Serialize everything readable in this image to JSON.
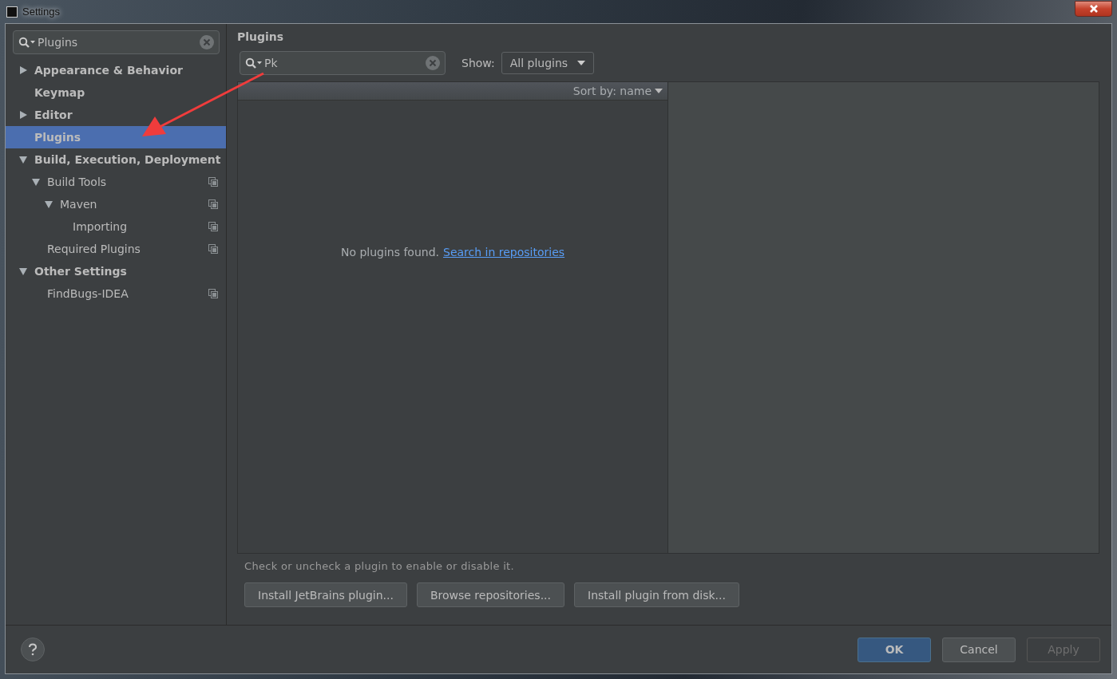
{
  "window": {
    "title": "Settings"
  },
  "sidebar": {
    "search": {
      "value": "Plugins"
    },
    "items": [
      {
        "label": "Appearance & Behavior",
        "expanded": false,
        "selected": false,
        "project_icon": false
      },
      {
        "label": "Keymap",
        "selected": false,
        "project_icon": false
      },
      {
        "label": "Editor",
        "expanded": false,
        "selected": false,
        "project_icon": false
      },
      {
        "label": "Plugins",
        "selected": true,
        "project_icon": false
      },
      {
        "label": "Build, Execution, Deployment",
        "expanded": true,
        "selected": false,
        "project_icon": false,
        "children": [
          {
            "label": "Build Tools",
            "expanded": true,
            "selected": false,
            "project_icon": true,
            "children": [
              {
                "label": "Maven",
                "expanded": true,
                "selected": false,
                "project_icon": true,
                "children": [
                  {
                    "label": "Importing",
                    "selected": false,
                    "project_icon": true
                  }
                ]
              }
            ]
          },
          {
            "label": "Required Plugins",
            "selected": false,
            "project_icon": true
          }
        ]
      },
      {
        "label": "Other Settings",
        "expanded": true,
        "selected": false,
        "project_icon": false,
        "children": [
          {
            "label": "FindBugs-IDEA",
            "selected": false,
            "project_icon": true
          }
        ]
      }
    ]
  },
  "content": {
    "title": "Plugins",
    "search": {
      "value": "Pk"
    },
    "show_label": "Show:",
    "show_value": "All plugins",
    "sort_label": "Sort by: name",
    "empty_text": "No plugins found.",
    "empty_link": "Search in repositories",
    "hint": "Check or uncheck a plugin to enable or disable it.",
    "buttons": [
      "Install JetBrains plugin...",
      "Browse repositories...",
      "Install plugin from disk..."
    ]
  },
  "footer": {
    "buttons": [
      {
        "label": "OK",
        "kind": "primary",
        "disabled": false
      },
      {
        "label": "Cancel",
        "kind": "normal",
        "disabled": false
      },
      {
        "label": "Apply",
        "kind": "normal",
        "disabled": true
      }
    ]
  }
}
